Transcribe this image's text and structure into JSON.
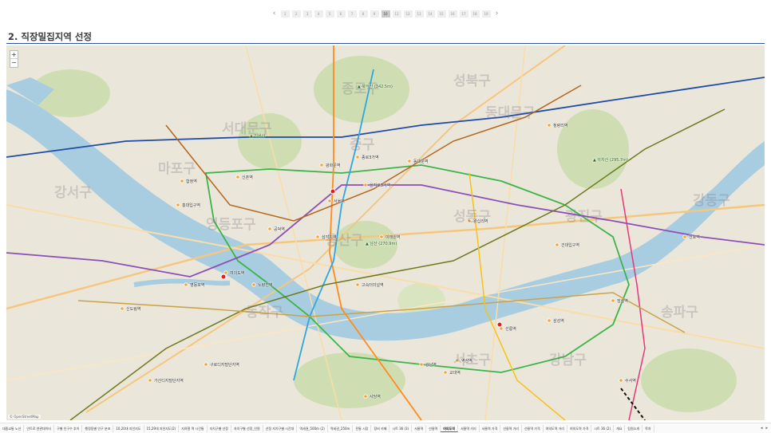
{
  "pager": {
    "prev": "‹",
    "next": "›",
    "pages": [
      "1",
      "2",
      "3",
      "4",
      "5",
      "6",
      "7",
      "8",
      "9",
      "10",
      "11",
      "12",
      "13",
      "14",
      "15",
      "16",
      "17",
      "18",
      "19"
    ],
    "active_index": 9
  },
  "section_title": "2. 직장밀집지역 선정",
  "map": {
    "attribution": "© OpenStreetMap",
    "zoom_in": "+",
    "zoom_out": "−",
    "districts": [
      "종로구",
      "성북구",
      "동대문구",
      "서대문구",
      "마포구",
      "중구",
      "용산구",
      "성동구",
      "광진구",
      "강서구",
      "영등포구",
      "동작구",
      "서초구",
      "강남구",
      "송파구",
      "강동구"
    ],
    "stations": [
      "광화문역",
      "종로3가역",
      "을지로3가역",
      "서울역",
      "삼각지역",
      "공덕역",
      "합정역",
      "여의도역",
      "영등포역",
      "신도림역",
      "노량진역",
      "고속터미널역",
      "강남역",
      "역삼역",
      "선릉역",
      "삼성역",
      "잠실역",
      "건대입구역",
      "왕십리역",
      "청량리역",
      "동대문역",
      "홍대입구역",
      "신촌역",
      "이태원역",
      "사당역",
      "교대역",
      "천호역",
      "가산디지털단지역",
      "구로디지털단지역",
      "수서역"
    ],
    "peaks": [
      "북악산 (342.5m)",
      "남산 (270.9m)",
      "인왕산",
      "아차산 (295.7m)"
    ]
  },
  "tabs": [
    "대중교통 노선",
    "인트로 연관데이터",
    "구별 인구수 추이",
    "행정동별 인구 분포",
    "10,20대 지인지도",
    "15,29대 지인지도(2)",
    "지하철 역 시간통",
    "자치구별 선정",
    "자치구별 선정_인원",
    "선정 자치구별 시간대",
    "역세권_500m (2)",
    "역세권_250m",
    "전통 시장",
    "장비 카페",
    "시트 36 (3)",
    "서울역",
    "선릉역",
    "여의도역",
    "서울역 거리",
    "서울역 가격",
    "선릉역 거리",
    "선릉역 가격",
    "여의도역 거리",
    "여의도역 가격",
    "시트 36 (2)",
    "개요",
    "팀원소개",
    "목차"
  ],
  "active_tab_index": 17,
  "colors": {
    "title_rule": "#2f4fa8",
    "river": "#a9cde0",
    "park": "#cfdeb2",
    "line2": "#3bb44a",
    "line1": "#1f4aa8"
  }
}
